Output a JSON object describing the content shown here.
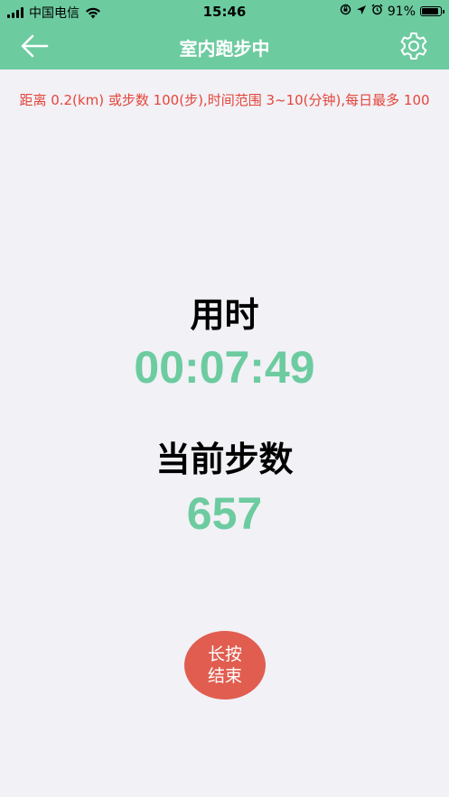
{
  "status_bar": {
    "carrier": "中国电信",
    "time": "15:46",
    "battery_text": "91%",
    "battery_level": 0.91
  },
  "navbar": {
    "title": "室内跑步中",
    "back_icon": "arrow-left-icon",
    "settings_icon": "gear-icon"
  },
  "notice": "距离 0.2(km) 或步数 100(步),时间范围 3~10(分钟),每日最多 100",
  "stats": {
    "time_label": "用时",
    "time_value": "00:07:49",
    "steps_label": "当前步数",
    "steps_value": "657"
  },
  "end_button": {
    "line1": "长按",
    "line2": "结束"
  },
  "colors": {
    "accent": "#6dcba0",
    "warning": "#e4453a",
    "end_button": "#e05d50",
    "background": "#f2f1f6"
  }
}
